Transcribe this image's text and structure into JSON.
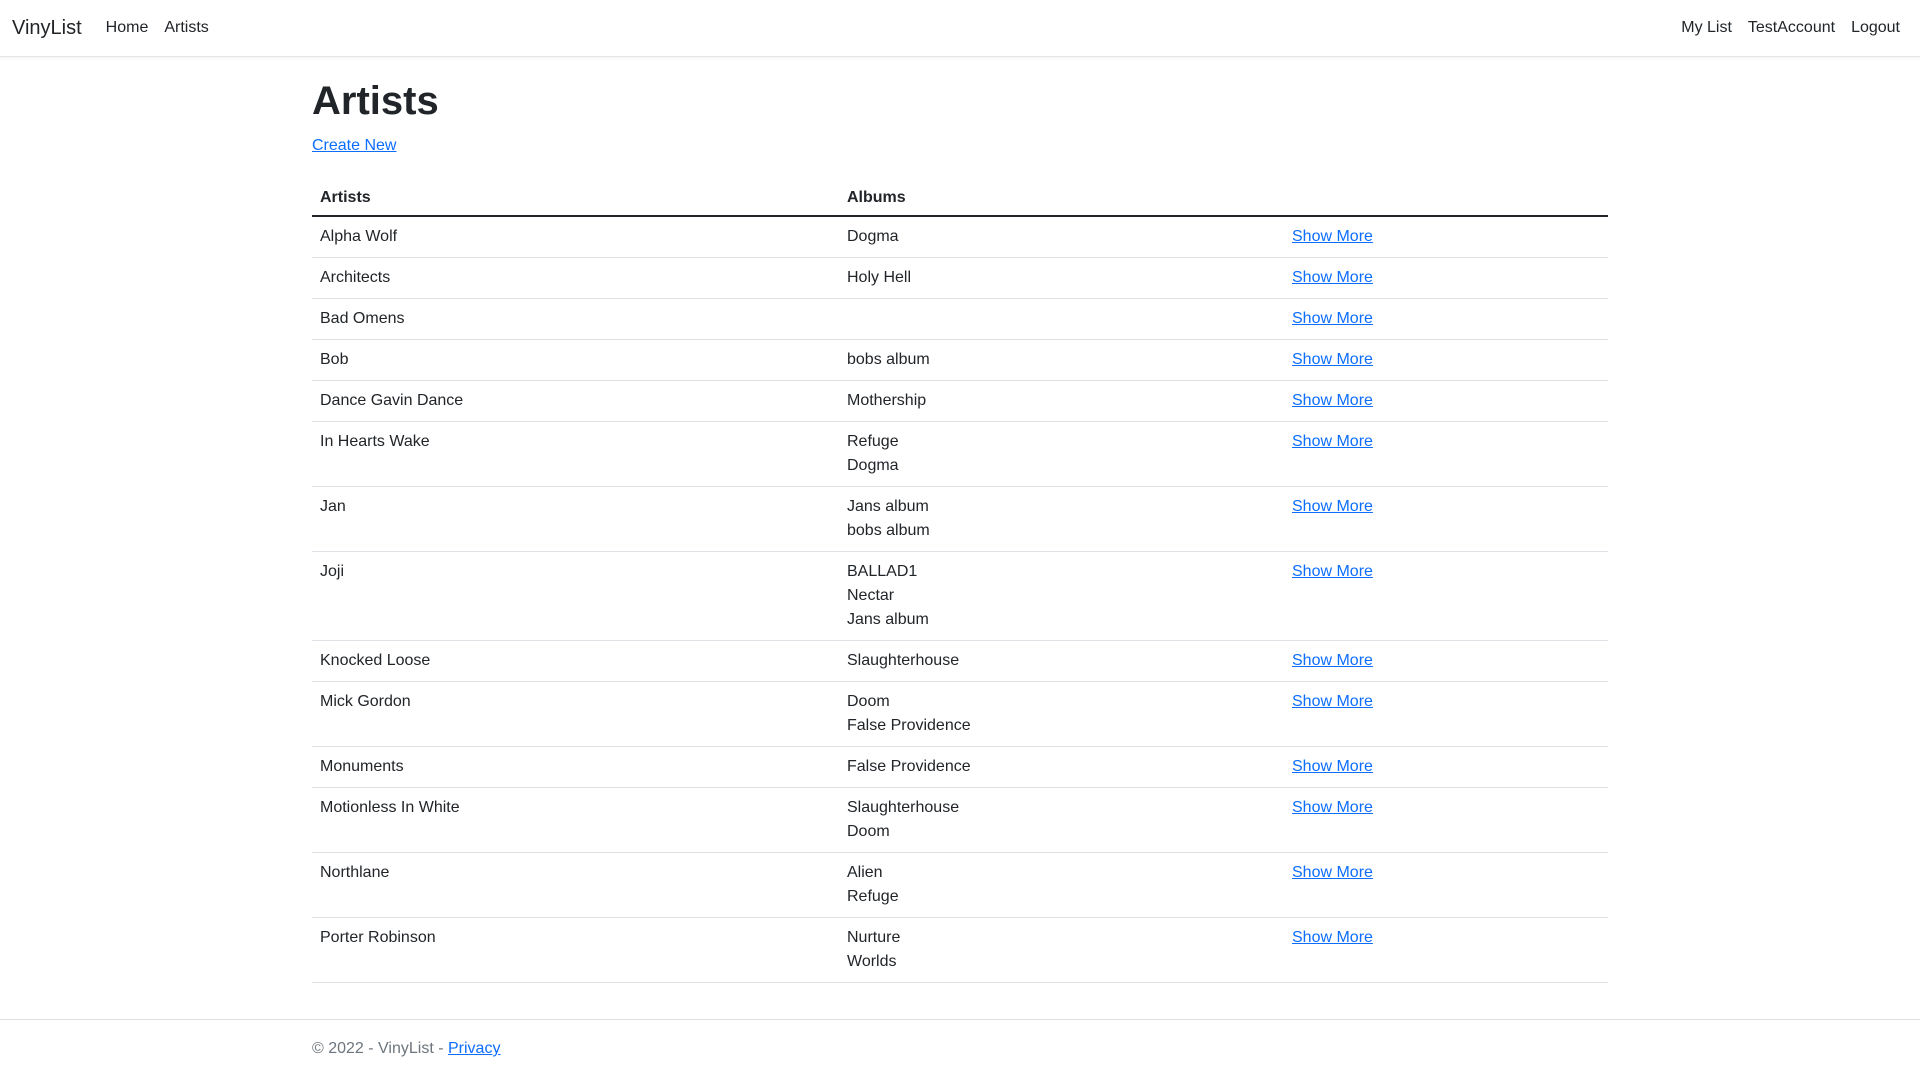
{
  "nav": {
    "brand": "VinyList",
    "left_links": [
      "Home",
      "Artists"
    ],
    "right_links": [
      "My List",
      "TestAccount",
      "Logout"
    ]
  },
  "page": {
    "title": "Artists",
    "create_new": "Create New"
  },
  "table": {
    "headers": [
      "Artists",
      "Albums",
      ""
    ],
    "show_more_label": "Show More",
    "rows": [
      {
        "artist": "Alpha Wolf",
        "albums": [
          "Dogma"
        ]
      },
      {
        "artist": "Architects",
        "albums": [
          "Holy Hell"
        ]
      },
      {
        "artist": "Bad Omens",
        "albums": []
      },
      {
        "artist": "Bob",
        "albums": [
          "bobs album"
        ]
      },
      {
        "artist": "Dance Gavin Dance",
        "albums": [
          "Mothership"
        ]
      },
      {
        "artist": "In Hearts Wake",
        "albums": [
          "Refuge",
          "Dogma"
        ]
      },
      {
        "artist": "Jan",
        "albums": [
          "Jans album",
          "bobs album"
        ]
      },
      {
        "artist": "Joji",
        "albums": [
          "BALLAD1",
          "Nectar",
          "Jans album"
        ]
      },
      {
        "artist": "Knocked Loose",
        "albums": [
          "Slaughterhouse"
        ]
      },
      {
        "artist": "Mick Gordon",
        "albums": [
          "Doom",
          "False Providence"
        ]
      },
      {
        "artist": "Monuments",
        "albums": [
          "False Providence"
        ]
      },
      {
        "artist": "Motionless In White",
        "albums": [
          "Slaughterhouse",
          "Doom"
        ]
      },
      {
        "artist": "Northlane",
        "albums": [
          "Alien",
          "Refuge"
        ]
      },
      {
        "artist": "Porter Robinson",
        "albums": [
          "Nurture",
          "Worlds"
        ]
      }
    ]
  },
  "footer": {
    "text": "© 2022 - VinyList - ",
    "privacy": "Privacy"
  }
}
